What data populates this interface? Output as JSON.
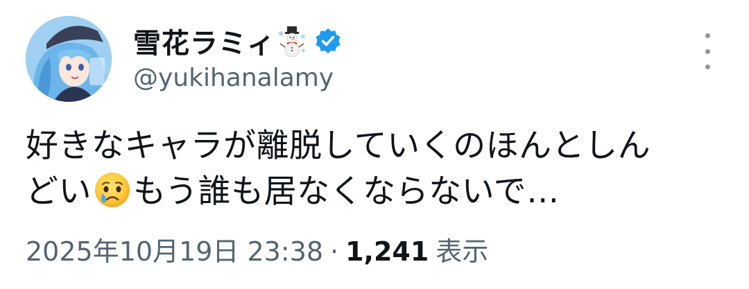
{
  "author": {
    "display_name": "雪花ラミィ",
    "name_emoji": "snowman-icon",
    "verified_icon": "verified-badge-icon",
    "handle": "@yukihanalamy",
    "avatar": "avatar-image"
  },
  "tweet": {
    "text_line1": "好きなキャラが離脱していくのほんとしん",
    "text_line2_a": "どい",
    "text_emoji": "crying-face-emoji",
    "text_line2_b": "もう誰も居なくならないで…"
  },
  "meta": {
    "timestamp": "2025年10月19日 23:38",
    "separator": "·",
    "views_count": "1,241",
    "views_label": "表示"
  },
  "colors": {
    "text_primary": "#0f1419",
    "text_secondary": "#536471",
    "verified_blue": "#1d9bf0"
  },
  "more_icon": "more-vertical-icon"
}
